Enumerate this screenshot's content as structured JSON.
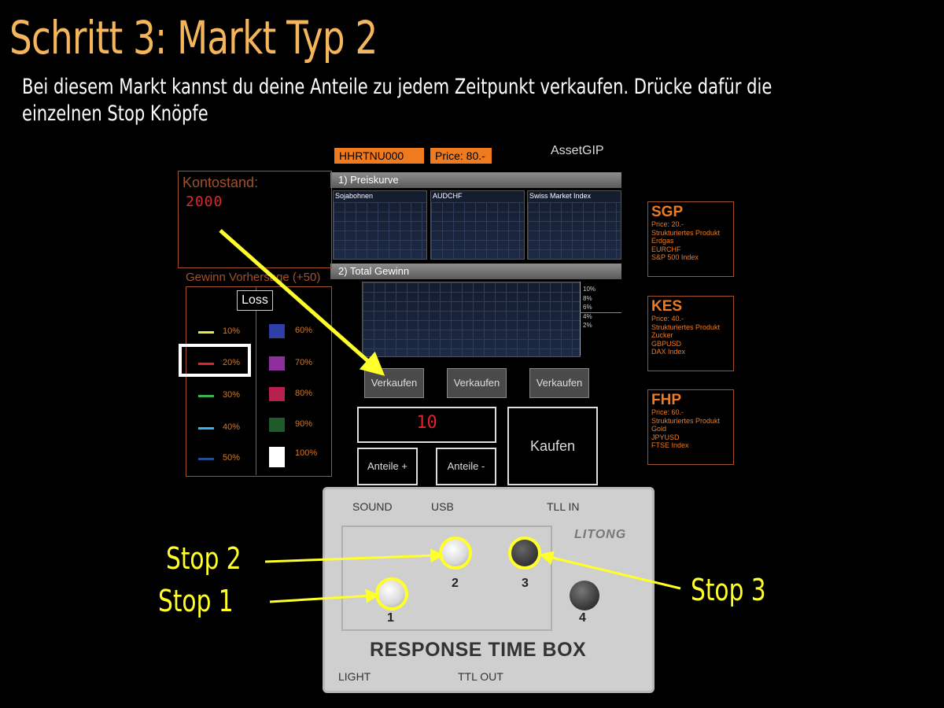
{
  "slide": {
    "title": "Schritt 3: Markt Typ 2",
    "subtitle_line1": "Bei diesem Markt kannst du deine Anteile zu jedem Zeitpunkt verkaufen. Drücke dafür die",
    "subtitle_line2": "einzelnen Stop Knöpfe"
  },
  "app": {
    "participant_code": "HHRTNU000",
    "price": "Price: 80.-",
    "app_name": "AssetGIP",
    "section1": "1) Preiskurve",
    "section2": "2) Total Gewinn",
    "charts": [
      "Sojabohnen",
      "AUDCHF",
      "Swiss Market Index"
    ],
    "profit_ticks": [
      "10%",
      "8%",
      "6%",
      "4%",
      "2%"
    ],
    "account_label": "Kontostand:",
    "account_value": "2000",
    "gewinn_label": "Gewinn Vorhersage (+50)",
    "loss_label": "Loss",
    "legend_left": [
      {
        "label": "10%",
        "color": "#e8e84a"
      },
      {
        "label": "20%",
        "color": "#e0242a"
      },
      {
        "label": "30%",
        "color": "#3cb34a"
      },
      {
        "label": "40%",
        "color": "#3ab3e8"
      },
      {
        "label": "50%",
        "color": "#1f4f8f"
      }
    ],
    "legend_right": [
      {
        "label": "60%",
        "color": "#2e3fa8"
      },
      {
        "label": "70%",
        "color": "#8e2fa0"
      },
      {
        "label": "80%",
        "color": "#b8204e"
      },
      {
        "label": "90%",
        "color": "#1e5a2a"
      },
      {
        "label": "100%",
        "color": "#ffffff"
      }
    ],
    "sell_buttons": [
      "Verkaufen",
      "Verkaufen",
      "Verkaufen"
    ],
    "shares_value": "10",
    "shares_plus": "Anteile +",
    "shares_minus": "Anteile -",
    "buy_label": "Kaufen",
    "stocks": [
      {
        "code": "SGP",
        "price": "Price: 20.-",
        "type": "Strukturiertes Produkt",
        "u1": "Erdgas",
        "u2": "EURCHF",
        "u3": "S&P 500 Index"
      },
      {
        "code": "KES",
        "price": "Price: 40.-",
        "type": "Strukturiertes Produkt",
        "u1": "Zucker",
        "u2": "GBPUSD",
        "u3": "DAX Index"
      },
      {
        "code": "FHP",
        "price": "Price: 60.-",
        "type": "Strukturiertes Produkt",
        "u1": "Gold",
        "u2": "JPYUSD",
        "u3": "FTSE Index"
      }
    ]
  },
  "rtb": {
    "sound": "SOUND",
    "usb": "USB",
    "ttl_in": "TLL IN",
    "logo": "LITONG",
    "title": "RESPONSE TIME BOX",
    "light": "LIGHT",
    "ttl_out": "TTL OUT",
    "buttons": [
      "1",
      "2",
      "3",
      "4"
    ]
  },
  "annotations": {
    "stop1": "Stop 1",
    "stop2": "Stop 2",
    "stop3": "Stop 3",
    "arrow_color": "#ffff2a"
  }
}
